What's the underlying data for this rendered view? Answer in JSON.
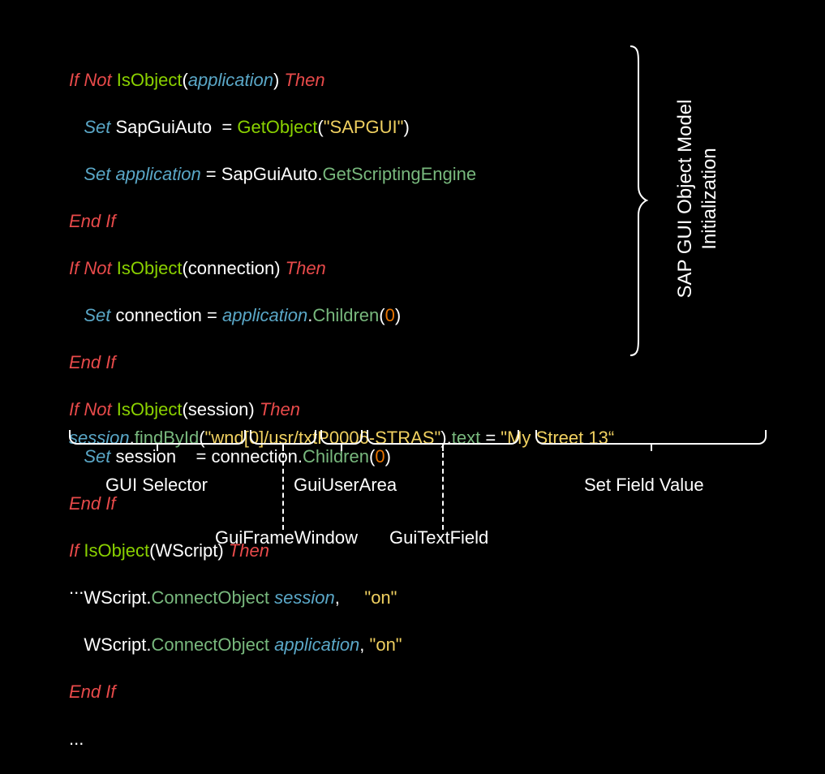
{
  "rightLabel": {
    "line1": "SAP GUI Object Model",
    "line2": "Initialization"
  },
  "code": {
    "l1_if": "If",
    "l1_not": "Not",
    "l1_isobj": "IsObject",
    "l1_app": "application",
    "l1_then": "Then",
    "l2_set": "Set",
    "l2_var": "SapGuiAuto  ",
    "l2_eq": "= ",
    "l2_get": "GetObject",
    "l2_str": "\"SAPGUI\"",
    "l3_set": "Set",
    "l3_var": "application",
    "l3_eq": " = SapGuiAuto.",
    "l3_m": "GetScriptingEngine",
    "l4_end": "End If",
    "l5_if": "If",
    "l5_not": "Not",
    "l5_isobj": "IsObject",
    "l5_arg": "connection",
    "l5_then": "Then",
    "l6_set": "Set",
    "l6_var": "connection",
    "l6_eq": " = ",
    "l6_obj": "application",
    "l6_dot": ".",
    "l6_m": "Children",
    "l6_n": "0",
    "l7_end": "End If",
    "l8_if": "If",
    "l8_not": "Not",
    "l8_isobj": "IsObject",
    "l8_arg": "session",
    "l8_then": "Then",
    "l9_set": "Set",
    "l9_var": "session   ",
    "l9_eq": " = connection.",
    "l9_m": "Children",
    "l9_n": "0",
    "l10_end": "End If",
    "l11_if": "If",
    "l11_isobj": "IsObject",
    "l11_arg": "WScript",
    "l11_then": "Then",
    "l12_pre": "   WScript.",
    "l12_m": "ConnectObject",
    "l12_sp": " ",
    "l12_a": "session",
    "l12_c": ",     ",
    "l12_s": "\"on\"",
    "l13_pre": "   WScript.",
    "l13_m": "ConnectObject",
    "l13_sp": " ",
    "l13_a": "application",
    "l13_c": ", ",
    "l13_s": "\"on\"",
    "l14_end": "End If",
    "l15": "...",
    "s_obj": "session",
    "s_dot1": ".",
    "s_find": "findById",
    "s_op": "(",
    "s_str": "\"wnd[0]/usr/txtP0006-STRAS\"",
    "s_cp": ")",
    "s_dot2": ".",
    "s_txt": "text",
    "s_eq": " = ",
    "s_val": "\"My Street 13“",
    "ell2": "..."
  },
  "labels": {
    "guiSelector": "GUI Selector",
    "guiFrameWindow": "GuiFrameWindow",
    "guiUserArea": "GuiUserArea",
    "guiTextField": "GuiTextField",
    "setFieldValue": "Set Field Value"
  }
}
